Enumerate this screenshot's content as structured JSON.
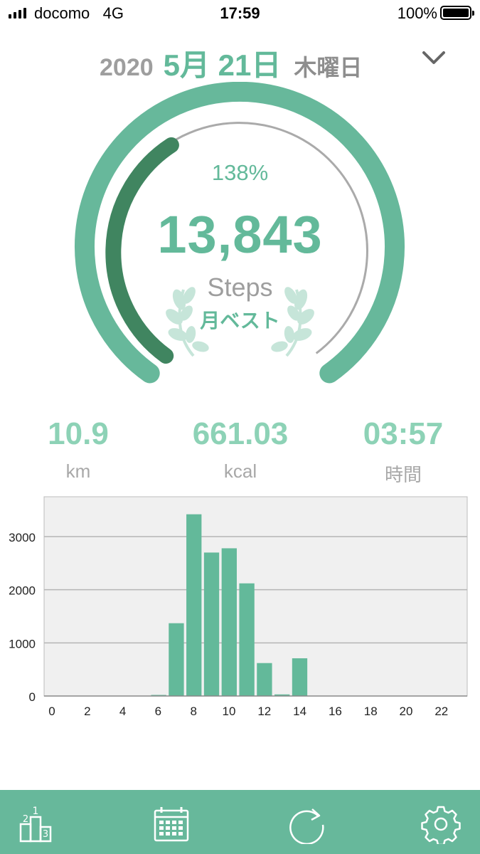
{
  "status_bar": {
    "carrier": "docomo",
    "network": "4G",
    "time": "17:59",
    "battery": "100%"
  },
  "header": {
    "year": "2020",
    "month_day": "5月 21日",
    "weekday": "木曜日",
    "expand_icon": "chevron-down-icon"
  },
  "gauge": {
    "percent": "138%",
    "percent_value": 138,
    "steps": "13,843",
    "unit": "Steps",
    "badge": "月ベスト"
  },
  "stats": {
    "distance": {
      "value": "10.9",
      "label": "km"
    },
    "calories": {
      "value": "661.03",
      "label": "kcal"
    },
    "duration": {
      "value": "03:57",
      "label": "時間"
    }
  },
  "chart_data": {
    "type": "bar",
    "x": [
      0,
      1,
      2,
      3,
      4,
      5,
      6,
      7,
      8,
      9,
      10,
      11,
      12,
      13,
      14,
      15,
      16,
      17,
      18,
      19,
      20,
      21,
      22,
      23
    ],
    "values": [
      0,
      0,
      0,
      0,
      0,
      0,
      20,
      1370,
      3420,
      2700,
      2780,
      2120,
      620,
      30,
      710,
      0,
      0,
      0,
      0,
      0,
      0,
      0,
      0,
      0
    ],
    "x_ticks": [
      "0",
      "2",
      "4",
      "6",
      "8",
      "10",
      "12",
      "14",
      "16",
      "18",
      "20",
      "22"
    ],
    "y_ticks": [
      "0",
      "1000",
      "2000",
      "3000"
    ],
    "ylim": [
      0,
      3750
    ],
    "grid": true,
    "xlabel": "",
    "ylabel": "",
    "title": ""
  },
  "tabbar": {
    "items": [
      {
        "icon": "ranking-podium-icon"
      },
      {
        "icon": "calendar-icon"
      },
      {
        "icon": "refresh-icon"
      },
      {
        "icon": "gear-icon"
      }
    ]
  },
  "colors": {
    "accent": "#63b99a",
    "accent_dark": "#408560",
    "accent_light": "#8dd2b6",
    "tabbar": "#67b89b",
    "chart_bg": "#f0f0f0"
  }
}
